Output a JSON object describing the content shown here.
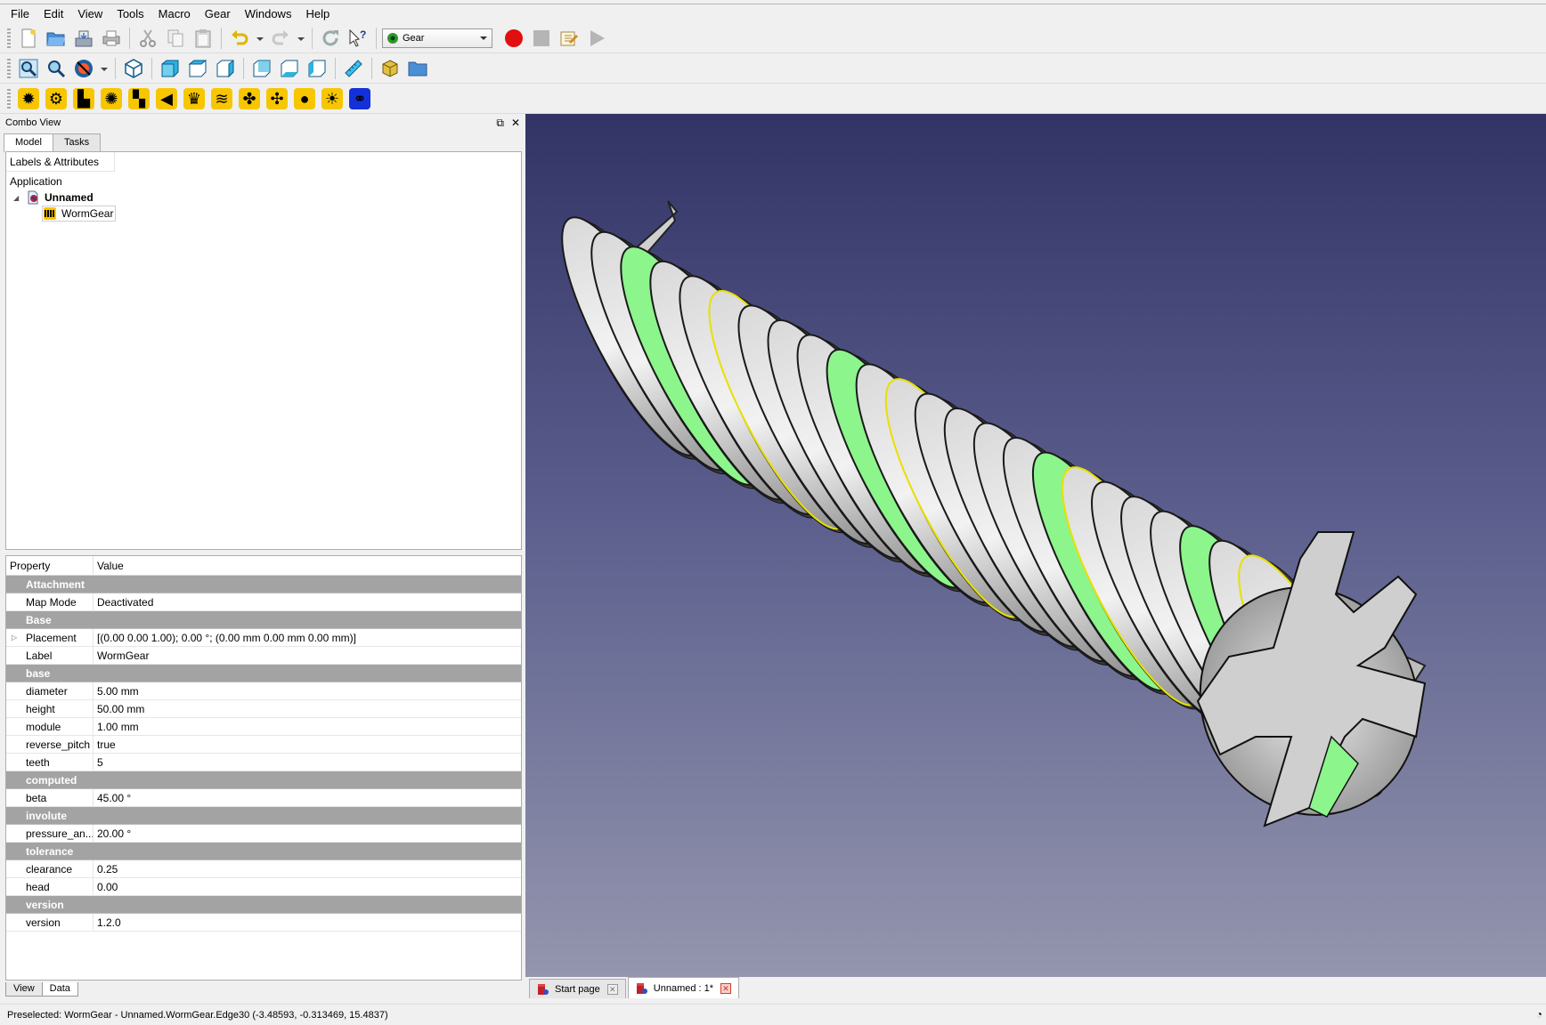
{
  "menu": [
    "File",
    "Edit",
    "View",
    "Tools",
    "Macro",
    "Gear",
    "Windows",
    "Help"
  ],
  "toolbar": {
    "workbench": "Gear"
  },
  "combo": {
    "title": "Combo View",
    "tabs": [
      "Model",
      "Tasks"
    ],
    "tree_header": "Labels & Attributes",
    "application": "Application",
    "document": "Unnamed",
    "object": "WormGear"
  },
  "properties": {
    "header_property": "Property",
    "header_value": "Value",
    "rows": [
      {
        "type": "group",
        "name": "Attachment"
      },
      {
        "type": "prop",
        "name": "Map Mode",
        "value": "Deactivated"
      },
      {
        "type": "group",
        "name": "Base"
      },
      {
        "type": "prop",
        "name": "Placement",
        "value": "[(0.00 0.00 1.00); 0.00 °; (0.00 mm  0.00 mm  0.00 mm)]",
        "expandable": true
      },
      {
        "type": "prop",
        "name": "Label",
        "value": "WormGear"
      },
      {
        "type": "group",
        "name": "base"
      },
      {
        "type": "prop",
        "name": "diameter",
        "value": "5.00 mm"
      },
      {
        "type": "prop",
        "name": "height",
        "value": "50.00 mm"
      },
      {
        "type": "prop",
        "name": "module",
        "value": "1.00 mm"
      },
      {
        "type": "prop",
        "name": "reverse_pitch",
        "value": "true"
      },
      {
        "type": "prop",
        "name": "teeth",
        "value": "5"
      },
      {
        "type": "group",
        "name": "computed"
      },
      {
        "type": "prop",
        "name": "beta",
        "value": "45.00 °"
      },
      {
        "type": "group",
        "name": "involute"
      },
      {
        "type": "prop",
        "name": "pressure_an...",
        "value": "20.00 °"
      },
      {
        "type": "group",
        "name": "tolerance"
      },
      {
        "type": "prop",
        "name": "clearance",
        "value": "0.25"
      },
      {
        "type": "prop",
        "name": "head",
        "value": "0.00"
      },
      {
        "type": "group",
        "name": "version"
      },
      {
        "type": "prop",
        "name": "version",
        "value": "1.2.0"
      }
    ],
    "bottom_tabs": [
      "View",
      "Data"
    ]
  },
  "doc_tabs": [
    {
      "label": "Start page",
      "active": false
    },
    {
      "label": "Unnamed : 1*",
      "active": true
    }
  ],
  "status": "Preselected: WormGear - Unnamed.WormGear.Edge30 (-3.48593, -0.313469, 15.4837)",
  "colors": {
    "viewport_top": "#333466",
    "viewport_bottom": "#9496ae",
    "group_row": "#a3a3a3",
    "highlight_green": "#8cf58c",
    "gear_yellow": "#f7c600"
  }
}
